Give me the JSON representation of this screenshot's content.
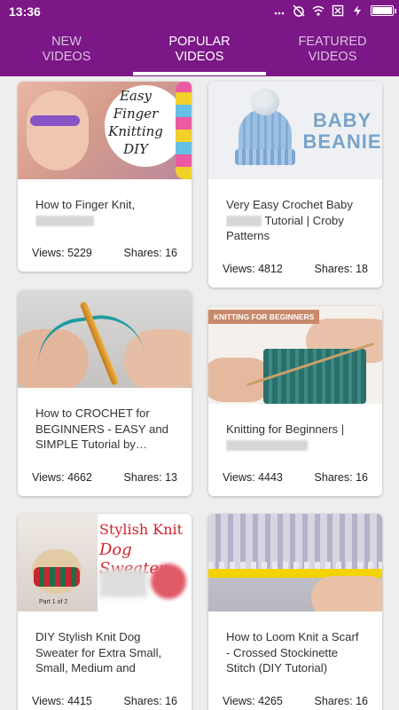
{
  "status_bar": {
    "time": "13:36",
    "icons": [
      "notification-dots-icon",
      "alarm-off-icon",
      "wifi-icon",
      "close-box-icon",
      "charging-icon",
      "battery-icon"
    ]
  },
  "tabs": [
    {
      "label": "NEW\nVIDEOS",
      "line1": "NEW",
      "line2": "VIDEOS",
      "active": false
    },
    {
      "label": "POPULAR\nVIDEOS",
      "line1": "POPULAR",
      "line2": "VIDEOS",
      "active": true
    },
    {
      "label": "FEATURED\nVIDEOS",
      "line1": "FEATURED",
      "line2": "VIDEOS",
      "active": false
    }
  ],
  "colors": {
    "primary": "#7b1787",
    "tab_indicator": "#ffffff",
    "background": "#eeeeee",
    "card": "#ffffff"
  },
  "cards": [
    {
      "thumb_text": "Easy Finger Knitting DIY",
      "title": "How to Finger Knit,",
      "views": "Views: 5229",
      "shares": "Shares: 16"
    },
    {
      "thumb_text": "BABY BEANIE",
      "title_part1": "Very Easy Crochet Baby",
      "title_part2": "Tutorial | Croby Patterns",
      "views": "Views: 4812",
      "shares": "Shares: 18"
    },
    {
      "title": "How to CROCHET for BEGINNERS - EASY and SIMPLE Tutorial by…",
      "views": "Views: 4662",
      "shares": "Shares: 13"
    },
    {
      "thumb_text": "KNITTING FOR BEGINNERS",
      "title": "Knitting for Beginners |",
      "views": "Views: 4443",
      "shares": "Shares: 16"
    },
    {
      "thumb_text_1": "Stylish Knit",
      "thumb_text_2": "Dog Sweater",
      "thumb_caption": "Part 1 of 2",
      "title": "DIY Stylish Knit Dog Sweater for Extra Small, Small, Medium and Larg…",
      "views": "Views: 4415",
      "shares": "Shares: 16"
    },
    {
      "title": "How to Loom Knit a Scarf - Crossed Stockinette Stitch (DIY Tutorial)",
      "views": "Views: 4265",
      "shares": "Shares: 16"
    }
  ]
}
